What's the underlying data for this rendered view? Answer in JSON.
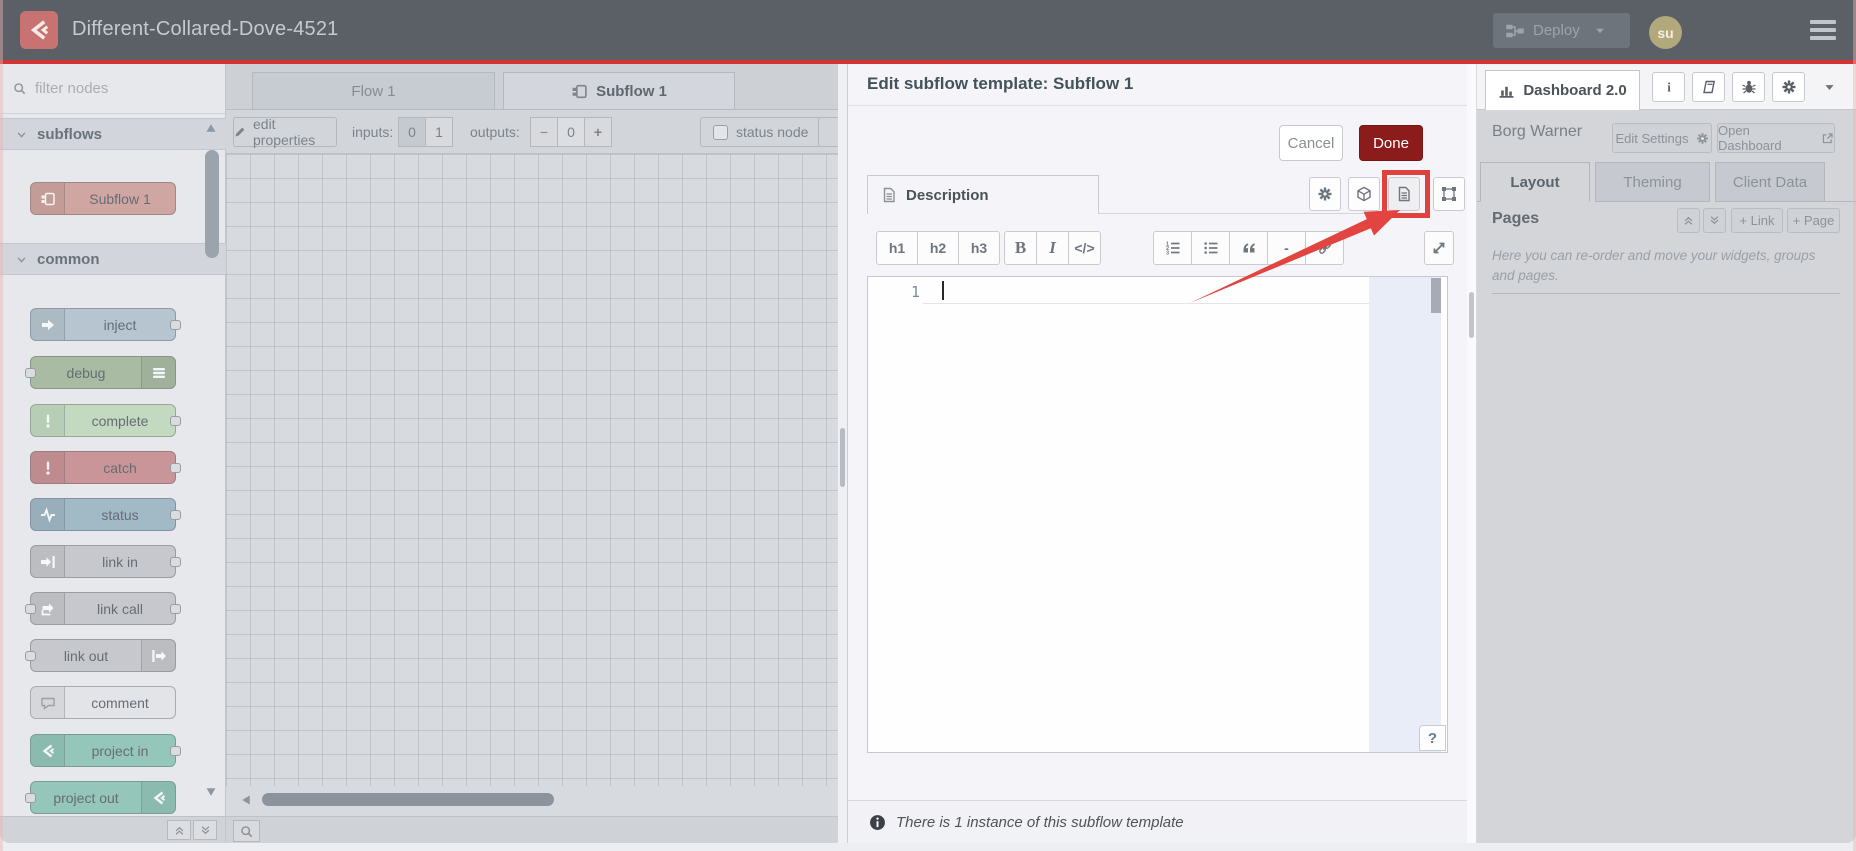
{
  "colors": {
    "header_accent": "#d23434",
    "done_button": "#8c1c1c",
    "annotation_red": "#e0413c"
  },
  "header": {
    "title": "Different-Collared-Dove-4521",
    "deploy_label": "Deploy",
    "avatar_label": "su"
  },
  "palette": {
    "search_placeholder": "filter nodes",
    "categories": [
      {
        "label": "subflows",
        "nodes": [
          {
            "label": "Subflow 1",
            "icon": "subflow",
            "color": "#cfa6a1",
            "icon_side": "left",
            "ports": "none"
          }
        ]
      },
      {
        "label": "common",
        "nodes": [
          {
            "label": "inject",
            "icon": "inject-arrow",
            "color": "#b6c5cf",
            "icon_side": "left",
            "ports": "right"
          },
          {
            "label": "debug",
            "icon": "debug-lines",
            "color": "#a9bca3",
            "icon_side": "right",
            "ports": "left"
          },
          {
            "label": "complete",
            "icon": "exclamation",
            "color": "#c3d9c0",
            "icon_side": "left",
            "ports": "right"
          },
          {
            "label": "catch",
            "icon": "exclamation",
            "color": "#c99598",
            "icon_side": "left",
            "ports": "right"
          },
          {
            "label": "status",
            "icon": "pulse",
            "color": "#a2b9c6",
            "icon_side": "left",
            "ports": "right"
          },
          {
            "label": "link in",
            "icon": "link-in",
            "color": "#c6c8cd",
            "icon_side": "left",
            "ports": "right"
          },
          {
            "label": "link call",
            "icon": "link-call",
            "color": "#c6c8cd",
            "icon_side": "left",
            "ports": "both"
          },
          {
            "label": "link out",
            "icon": "link-out",
            "color": "#c6c8cd",
            "icon_side": "right",
            "ports": "left"
          },
          {
            "label": "comment",
            "icon": "comment-bubble",
            "color": "#e3e4e8",
            "icon_side": "left",
            "ports": "none",
            "icon_muted": true
          },
          {
            "label": "project in",
            "icon": "nodered-mark",
            "color": "#94c6ba",
            "icon_side": "left",
            "ports": "right"
          },
          {
            "label": "project out",
            "icon": "nodered-mark",
            "color": "#94c6ba",
            "icon_side": "right",
            "ports": "left"
          }
        ]
      }
    ]
  },
  "workspace": {
    "tabs": [
      {
        "label": "Flow 1"
      },
      {
        "label": "Subflow 1"
      }
    ],
    "toolbar": {
      "edit_properties_label": "edit properties",
      "inputs_label": "inputs:",
      "input_options": [
        "0",
        "1"
      ],
      "inputs_selected": "0",
      "outputs_label": "outputs:",
      "outputs_minus": "−",
      "outputs_value": "0",
      "outputs_plus": "+",
      "status_node_label": "status node"
    }
  },
  "tray": {
    "title": "Edit subflow template: Subflow 1",
    "cancel_label": "Cancel",
    "done_label": "Done",
    "description_tab_label": "Description",
    "icon_buttons": [
      "gear",
      "cube",
      "file-text",
      "object-group"
    ],
    "highlighted_icon": "file-text",
    "md_toolbar_groups": [
      [
        {
          "name": "heading-1",
          "label": "h1"
        },
        {
          "name": "heading-2",
          "label": "h2"
        },
        {
          "name": "heading-3",
          "label": "h3"
        }
      ],
      [
        {
          "name": "bold",
          "label": "B",
          "style": "serifB"
        },
        {
          "name": "italic",
          "label": "I",
          "style": "serifI"
        },
        {
          "name": "code",
          "label": "</>"
        }
      ],
      [
        {
          "name": "ordered-list",
          "icon": "ol"
        },
        {
          "name": "unordered-list",
          "icon": "ul"
        },
        {
          "name": "blockquote",
          "icon": "quote"
        },
        {
          "name": "horizontal-rule",
          "label": "-"
        },
        {
          "name": "insert-link",
          "icon": "chain"
        }
      ]
    ],
    "editor": {
      "line_number": "1"
    },
    "help_button_label": "?",
    "footer_text": "There is 1 instance of this subflow template"
  },
  "sidebar": {
    "dashboard_tab_label": "Dashboard 2.0",
    "icon_buttons": [
      "info",
      "book",
      "bug",
      "gear"
    ],
    "dashboard_name": "Borg Warner",
    "edit_settings_label": "Edit Settings",
    "open_dashboard_label": "Open Dashboard",
    "tabs": [
      "Layout",
      "Theming",
      "Client Data"
    ],
    "pages": {
      "title": "Pages",
      "link_button_label": "+ Link",
      "page_button_label": "+ Page",
      "help_text": "Here you can re-order and move your widgets, groups and pages."
    }
  }
}
